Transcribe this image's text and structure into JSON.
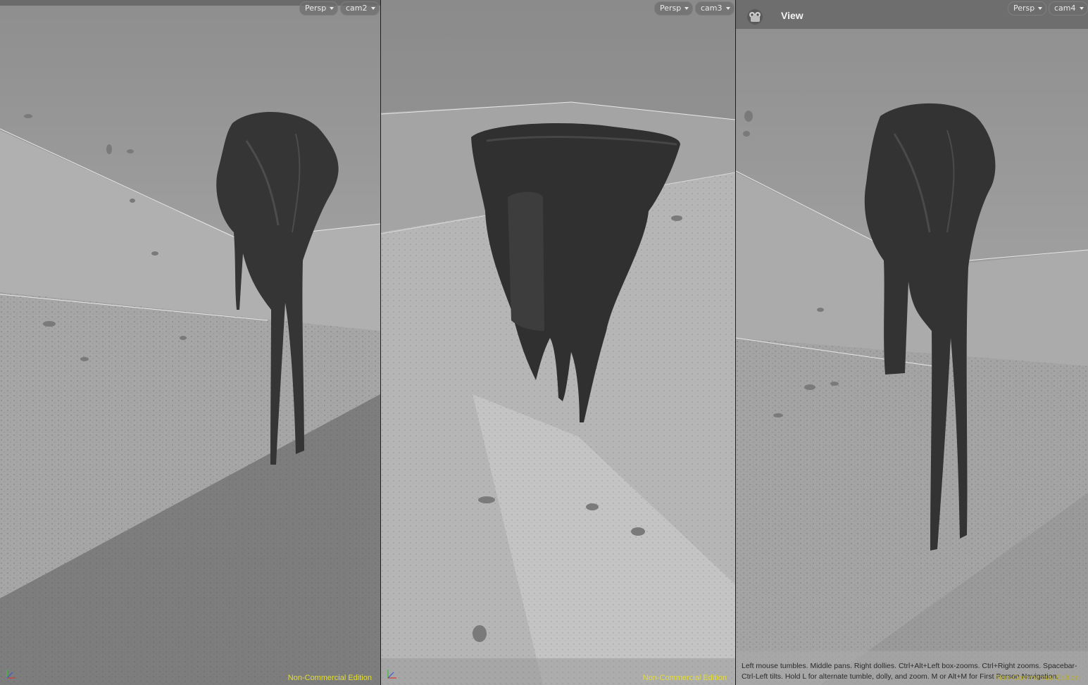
{
  "viewports": [
    {
      "projection_menu": "Persp",
      "camera_menu": "cam2",
      "edition_label": "Non-Commercial Edition"
    },
    {
      "projection_menu": "Persp",
      "camera_menu": "cam3",
      "edition_label": "Non-Commercial Edition"
    },
    {
      "title": "View",
      "projection_menu": "Persp",
      "camera_menu": "cam4",
      "edition_label": "Non-Commercial Edition",
      "help_text": "Left mouse tumbles. Middle pans. Right dollies. Ctrl+Alt+Left box-zooms. Ctrl+Right zooms. Spacebar-Ctrl-Left tilts. Hold L for alternate tumble, dolly, and zoom. M or Alt+M for First Person Navigation."
    }
  ],
  "colors": {
    "edition_text": "#e6df2e",
    "background": "#a3a3a3",
    "object": "#333333"
  },
  "icons": {
    "view_icon": "view-icon",
    "axis_gizmo": "axis-gizmo-icon",
    "menu_arrow": "chevron-down-icon"
  }
}
